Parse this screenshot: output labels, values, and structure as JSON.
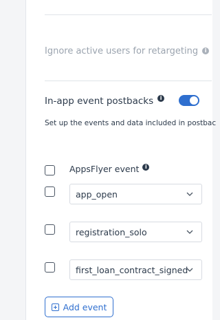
{
  "ignore_retargeting": {
    "label": "Ignore active users for retargeting",
    "info": "i"
  },
  "postbacks": {
    "label": "In-app event postbacks",
    "info": "i",
    "enabled": true,
    "description": "Set up the events and data included in postbac"
  },
  "events_table": {
    "header": "AppsFlyer event",
    "header_info": "i",
    "rows": [
      {
        "value": "app_open"
      },
      {
        "value": "registration_solo"
      },
      {
        "value": "first_loan_contract_signed"
      }
    ]
  },
  "add_event_label": "Add event",
  "colors": {
    "accent": "#2f6fcf",
    "text": "#2c3a4b",
    "muted": "#9ba4af"
  }
}
